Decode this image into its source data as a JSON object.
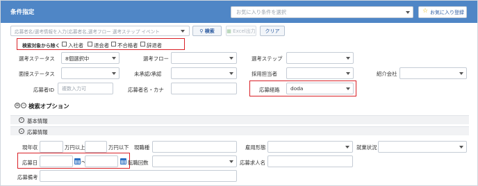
{
  "header": {
    "title": "条件指定",
    "favorite_select_placeholder": "お気に入り条件を選択",
    "favorite_register_button": "お気に入り登録"
  },
  "toolbar": {
    "search_placeholder": "応募者名/選考情報を入力(応募者名,選考フロー 選考ステップ イベント",
    "search_button": "検索",
    "excel_button": "Excel出力",
    "clear_button": "クリア"
  },
  "exclude": {
    "label": "検索対象から除く",
    "options": [
      "入社者",
      "退会者",
      "不合格者",
      "辞退者"
    ]
  },
  "filters": {
    "status_label": "選考ステータス",
    "status_value": "8個選択中",
    "flow_label": "選考フロー",
    "step_label": "選考ステップ",
    "interview_status_label": "面接ステータス",
    "approval_label": "未承認/承認",
    "recruiter_label": "採用担当者",
    "agency_label": "紹介会社",
    "applicant_id_label": "応募者ID",
    "applicant_id_placeholder": "複数入力可",
    "applicant_name_label": "応募者名・カナ",
    "route_label": "応募経路",
    "route_value": "doda"
  },
  "options_section": {
    "title": "検索オプション",
    "basic_info": "基本情報",
    "apply_info": "応募情報",
    "current_income_label": "現年収",
    "over_label": "万円以上",
    "under_label": "万円以下",
    "current_job_label": "現職種",
    "employment_label": "雇用形態",
    "work_status_label": "就業状況",
    "apply_date_label": "応募日",
    "job_changes_label": "転職回数",
    "job_posting_label": "応募求人名",
    "apply_note_label": "応募備考"
  },
  "colors": {
    "header_bg": "#4f86c6",
    "highlight": "#d91f25",
    "calendar_icon": "#2b6fc2"
  }
}
